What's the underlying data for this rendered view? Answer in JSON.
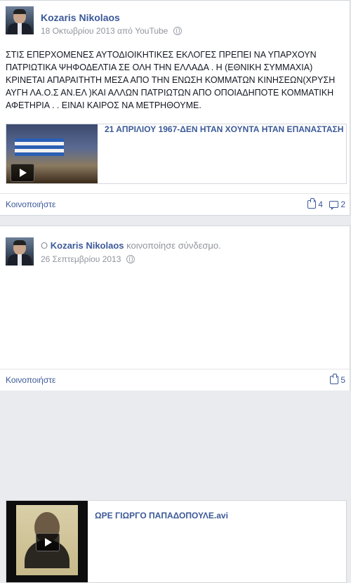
{
  "posts": [
    {
      "author": "Kozaris Nikolaos",
      "date": "18 Οκτωβρίου 2013",
      "via_prefix": "από",
      "via": "YouTube",
      "text": "ΣΤΙΣ ΕΠΕΡΧΟΜΕΝΕΣ ΑΥΤΟΔΙΟΙΚΗΤΙΚΕΣ ΕΚΛΟΓΕΣ ΠΡΕΠΕΙ ΝΑ ΥΠΑΡΧΟΥΝ ΠΑΤΡΙΩΤΙΚΑ ΨΗΦΟΔΕΛΤΙΑ ΣΕ ΟΛΗ ΤΗΝ ΕΛΛΑΔΑ . Η (ΕΘΝΙΚΗ ΣΥΜΜΑΧΙΑ) ΚΡΙΝΕΤΑΙ ΑΠΑΡΑΙΤΗΤΗ ΜΕΣΑ ΑΠΟ ΤΗΝ ΕΝΩΣΗ ΚΟΜΜΑΤΩΝ ΚΙΝΗΣΕΩΝ(ΧΡΥΣΗ ΑΥΓΗ ΛΑ.Ο.Σ ΑΝ.ΕΛ )ΚΑΙ ΑΛΛΩΝ ΠΑΤΡΙΩΤΩΝ ΑΠΟ ΟΠΟΙΑΔΗΠΟΤΕ ΚΟΜΜΑΤΙΚΗ ΑΦΕΤΗΡΙΑ . . ΕΙΝΑΙ ΚΑΙΡΟΣ ΝΑ ΜΕΤΡΗΘΟΥΜΕ.",
      "card_title": "21 ΑΠΡΙΛΙΟΥ 1967-ΔΕΝ ΗΤΑΝ ΧΟΥΝΤΑ ΗΤΑΝ ΕΠΑΝΑΣΤΑΣΗ",
      "share_label": "Κοινοποιήστε",
      "likes": "4",
      "comments": "2"
    },
    {
      "prefix": "Ο",
      "author": "Kozaris Nikolaos",
      "action": "κοινοποίησε σύνδεσμο.",
      "date": "26 Σεπτεμβρίου 2013",
      "card_title": "ΩΡΕ ΓΙΩΡΓΟ ΠΑΠΑΔΟΠΟΥΛΕ.avi",
      "share_label": "Κοινοποιήστε",
      "likes": "5"
    }
  ],
  "colors": {
    "link": "#3b5998",
    "meta": "#90949c",
    "background": "#e9ebee"
  }
}
